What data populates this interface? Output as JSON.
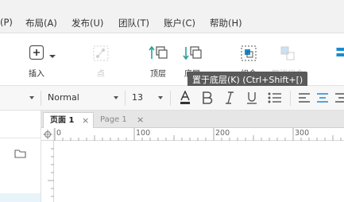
{
  "menubar": {
    "items": [
      "(P)",
      "布局(A)",
      "发布(U)",
      "团队(T)",
      "账户(C)",
      "帮助(H)"
    ]
  },
  "toolbar": {
    "insert_label": "插入",
    "point_label": "点",
    "top_label": "顶层",
    "bottom_label": "底层",
    "group_label": "组合",
    "ungroup_label": "取消组合"
  },
  "format": {
    "style_value": "Normal",
    "font_size": "13"
  },
  "tabs": [
    {
      "label": "页面 1",
      "active": true
    },
    {
      "label": "Page 1",
      "active": false
    }
  ],
  "tab_close": "×",
  "ruler": {
    "ticks": [
      "0",
      "100",
      "200",
      "300"
    ]
  },
  "tooltip": {
    "text": "置于底层(K) (Ctrl+Shift+[)"
  },
  "colors": {
    "accent": "#1a8ccf",
    "teal": "#2aa198",
    "disabled": "#c4c4c4"
  }
}
